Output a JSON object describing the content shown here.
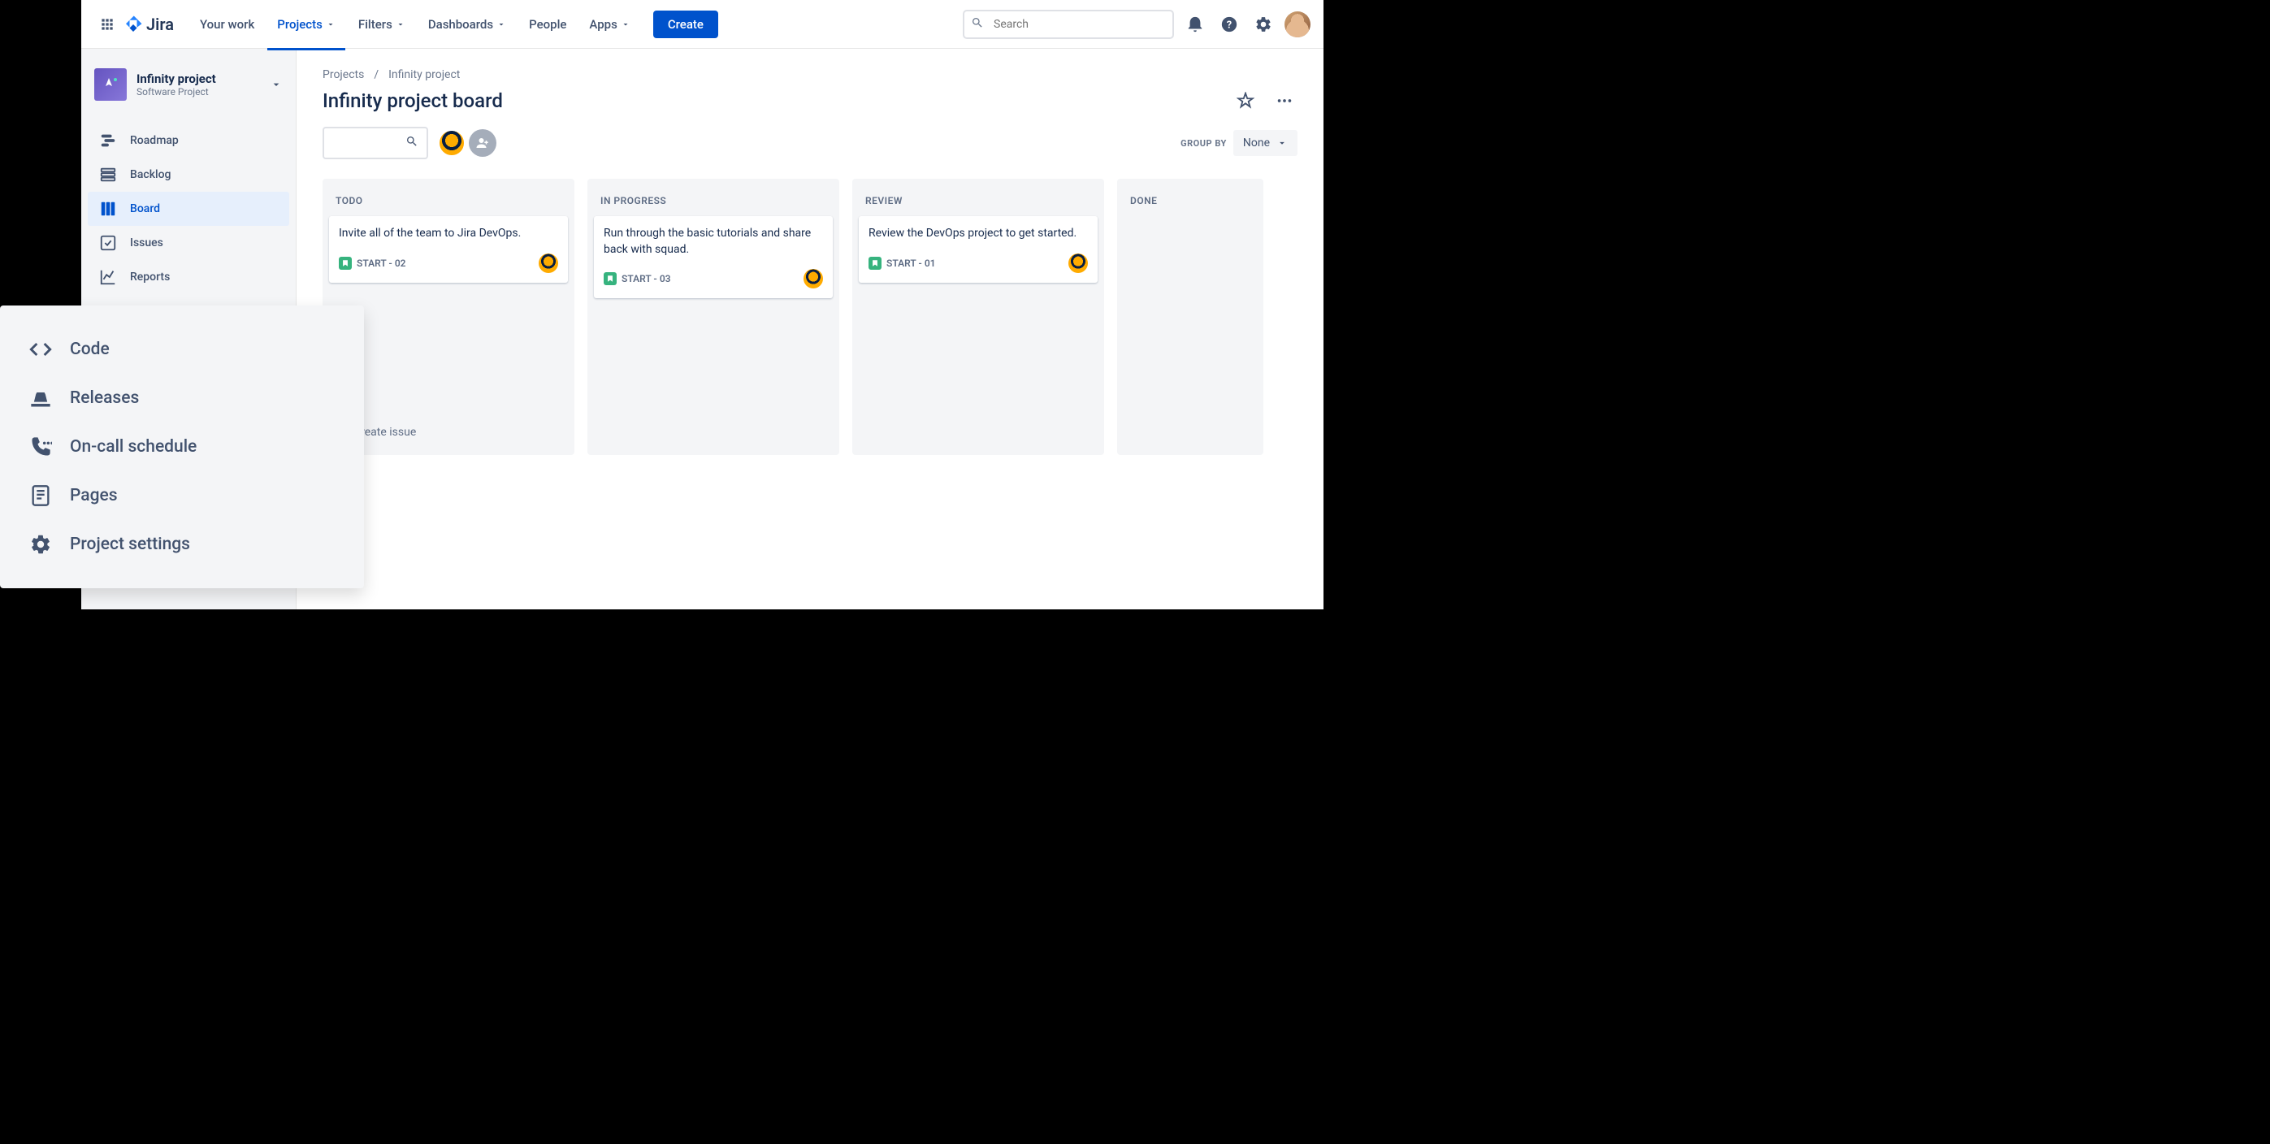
{
  "topnav": {
    "logo_text": "Jira",
    "items": [
      {
        "label": "Your work",
        "dropdown": false
      },
      {
        "label": "Projects",
        "dropdown": true,
        "active": true
      },
      {
        "label": "Filters",
        "dropdown": true
      },
      {
        "label": "Dashboards",
        "dropdown": true
      },
      {
        "label": "People",
        "dropdown": false
      },
      {
        "label": "Apps",
        "dropdown": true
      }
    ],
    "create_label": "Create",
    "search_placeholder": "Search"
  },
  "sidebar": {
    "project_name": "Infinity project",
    "project_type": "Software Project",
    "items": [
      {
        "label": "Roadmap",
        "icon": "roadmap"
      },
      {
        "label": "Backlog",
        "icon": "backlog"
      },
      {
        "label": "Board",
        "icon": "board",
        "active": true
      },
      {
        "label": "Issues",
        "icon": "issues"
      },
      {
        "label": "Reports",
        "icon": "reports"
      }
    ]
  },
  "breadcrumb": {
    "root": "Projects",
    "current": "Infinity project"
  },
  "page": {
    "title": "Infinity project board",
    "group_by_label": "GROUP BY",
    "group_by_value": "None",
    "create_issue_label": "Create issue"
  },
  "columns": [
    {
      "name": "TODO",
      "cards": [
        {
          "title": "Invite all of the team to Jira DevOps.",
          "key": "START - 02"
        }
      ],
      "show_create": true
    },
    {
      "name": "IN PROGRESS",
      "cards": [
        {
          "title": "Run through the basic tutorials and share back with squad.",
          "key": "START - 03"
        }
      ]
    },
    {
      "name": "REVIEW",
      "cards": [
        {
          "title": "Review the DevOps project to get started.",
          "key": "START - 01"
        }
      ]
    },
    {
      "name": "DONE",
      "cards": []
    }
  ],
  "overlay": {
    "items": [
      {
        "label": "Code",
        "icon": "code"
      },
      {
        "label": "Releases",
        "icon": "releases"
      },
      {
        "label": "On-call schedule",
        "icon": "oncall"
      },
      {
        "label": "Pages",
        "icon": "pages"
      },
      {
        "label": "Project settings",
        "icon": "settings"
      }
    ]
  }
}
